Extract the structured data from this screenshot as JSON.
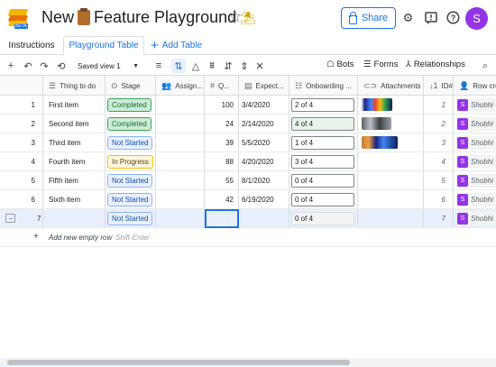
{
  "header": {
    "logo_badge": "BETA",
    "doc_title": "New",
    "doc_title_rest": "Feature Playground",
    "share_label": "Share",
    "avatar_initial": "S"
  },
  "tabs": {
    "items": [
      {
        "label": "Instructions"
      },
      {
        "label": "Playground Table"
      }
    ],
    "add_table_label": "Add Table"
  },
  "toolbar": {
    "saved_view": "Saved view 1",
    "bots_label": "Bots",
    "forms_label": "Forms",
    "relationships_label": "Relationships"
  },
  "columns": [
    {
      "label": "Thing to do",
      "icon": "text-icon"
    },
    {
      "label": "Stage",
      "icon": "status-icon"
    },
    {
      "label": "Assign...",
      "icon": "people-icon"
    },
    {
      "label": "Q...",
      "icon": "number-icon"
    },
    {
      "label": "Expect...",
      "icon": "calendar-icon"
    },
    {
      "label": "Onboarding ...",
      "icon": "checklist-icon"
    },
    {
      "label": "Attachments",
      "icon": "attachment-icon"
    },
    {
      "label": "ID#",
      "icon": "id-icon"
    },
    {
      "label": "Row cre",
      "icon": "user-icon"
    }
  ],
  "rows": [
    {
      "num": "1",
      "thing": "First item",
      "stage": "Completed",
      "stage_kind": "completed",
      "q": "100",
      "date": "3/4/2020",
      "onb": "2 of 4",
      "att": "g1",
      "id": "1",
      "creator_initial": "S",
      "creator": "Shobhi"
    },
    {
      "num": "2",
      "thing": "Second item",
      "stage": "Completed",
      "stage_kind": "completed",
      "q": "24",
      "date": "2/14/2020",
      "onb": "4 of 4",
      "att": "g2",
      "id": "2",
      "creator_initial": "S",
      "creator": "Shobhi"
    },
    {
      "num": "3",
      "thing": "Third item",
      "stage": "Not Started",
      "stage_kind": "notstarted",
      "q": "39",
      "date": "5/5/2020",
      "onb": "1 of 4",
      "att": "g3",
      "id": "3",
      "creator_initial": "S",
      "creator": "Shobhi"
    },
    {
      "num": "4",
      "thing": "Fourth item",
      "stage": "In Progress",
      "stage_kind": "inprogress",
      "q": "88",
      "date": "4/20/2020",
      "onb": "3 of 4",
      "att": "",
      "id": "4",
      "creator_initial": "S",
      "creator": "Shobhi"
    },
    {
      "num": "5",
      "thing": "Fifth item",
      "stage": "Not Started",
      "stage_kind": "notstarted",
      "q": "55",
      "date": "8/1/2020",
      "onb": "0 of 4",
      "att": "",
      "id": "5",
      "creator_initial": "S",
      "creator": "Shobhi"
    },
    {
      "num": "6",
      "thing": "Sixth item",
      "stage": "Not Started",
      "stage_kind": "notstarted",
      "q": "42",
      "date": "6/19/2020",
      "onb": "0 of 4",
      "att": "",
      "id": "6",
      "creator_initial": "S",
      "creator": "Shobhi"
    },
    {
      "num": "7",
      "thing": "",
      "stage": "Not Started",
      "stage_kind": "notstarted",
      "q": "",
      "date": "",
      "onb": "0 of 4",
      "att": "",
      "id": "7",
      "creator_initial": "S",
      "creator": "Shobhi"
    }
  ],
  "add_row": {
    "label": "Add new empty row",
    "hint": "Shift-Enter"
  }
}
